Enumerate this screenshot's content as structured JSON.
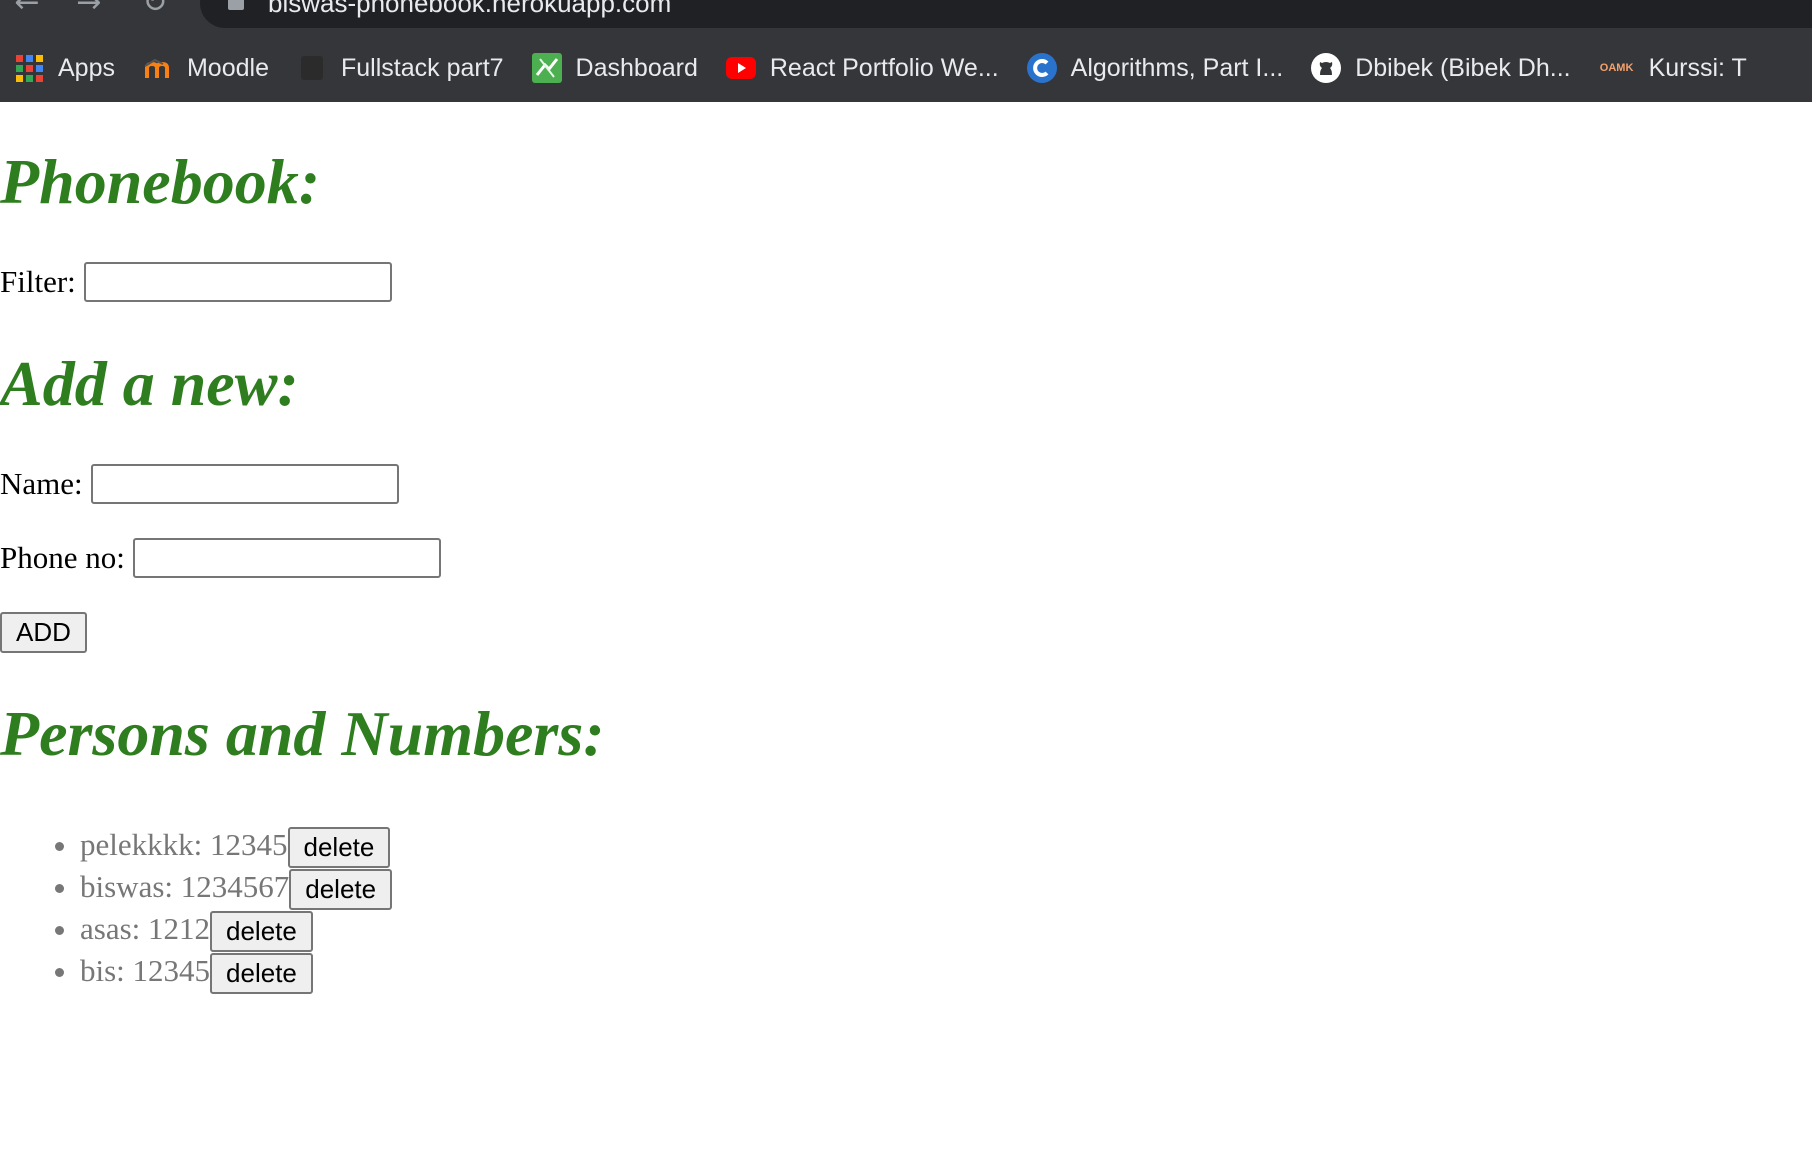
{
  "browser": {
    "url": "biswas-phonebook.herokuapp.com",
    "bookmarks": [
      {
        "label": "Apps",
        "icon": "apps-grid-icon"
      },
      {
        "label": "Moodle",
        "icon": "moodle-icon"
      },
      {
        "label": "Fullstack part7",
        "icon": "blank-page-icon"
      },
      {
        "label": "Dashboard",
        "icon": "dashboard-icon"
      },
      {
        "label": "React Portfolio We...",
        "icon": "youtube-icon"
      },
      {
        "label": "Algorithms, Part I...",
        "icon": "coursera-icon"
      },
      {
        "label": "Dbibek (Bibek Dh...",
        "icon": "github-icon"
      },
      {
        "label": "Kurssi: T",
        "icon": "oamk-icon",
        "icon_text": "OAMK"
      }
    ]
  },
  "phonebook": {
    "title": "Phonebook:",
    "filter_label": "Filter:",
    "filter_value": ""
  },
  "add_new": {
    "title": "Add a new:",
    "name_label": "Name:",
    "name_value": "",
    "phone_label": "Phone no:",
    "phone_value": "",
    "add_button": "ADD"
  },
  "persons": {
    "title": "Persons and Numbers:",
    "delete_label": "delete",
    "entries": [
      {
        "text": "pelekkkk: 12345"
      },
      {
        "text": "biswas: 1234567"
      },
      {
        "text": "asas: 1212"
      },
      {
        "text": "bis: 12345"
      }
    ]
  },
  "colors": {
    "heading": "#2e7d1e",
    "list_text": "#777777",
    "browser_chrome": "#35363a"
  }
}
